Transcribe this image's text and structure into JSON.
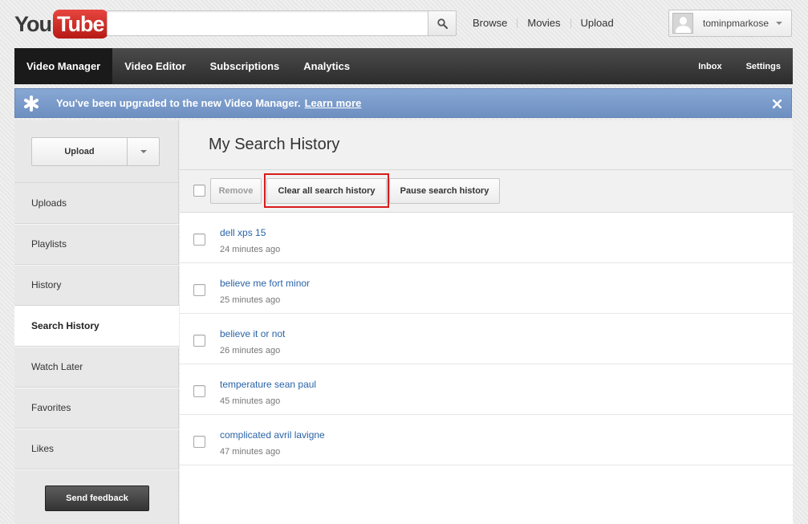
{
  "logo": {
    "you": "You",
    "tube": "Tube"
  },
  "search": {
    "value": "",
    "placeholder": ""
  },
  "top_links": [
    "Browse",
    "Movies",
    "Upload"
  ],
  "user": {
    "name": "tominpmarkose"
  },
  "nav": {
    "tabs": [
      "Video Manager",
      "Video Editor",
      "Subscriptions",
      "Analytics"
    ],
    "active": "Video Manager",
    "right": [
      "Inbox",
      "Settings"
    ]
  },
  "banner": {
    "text": "You've been upgraded to the new Video Manager.",
    "link": "Learn more"
  },
  "sidebar": {
    "upload_label": "Upload",
    "items": [
      "Uploads",
      "Playlists",
      "History",
      "Search History",
      "Watch Later",
      "Favorites",
      "Likes"
    ],
    "active": "Search History",
    "feedback_label": "Send feedback"
  },
  "main": {
    "title": "My Search History",
    "toolbar": {
      "remove": "Remove",
      "clear_all": "Clear all search history",
      "pause": "Pause search history"
    },
    "entries": [
      {
        "query": "dell xps 15",
        "time": "24 minutes ago"
      },
      {
        "query": "believe me fort minor",
        "time": "25 minutes ago"
      },
      {
        "query": "believe it or not",
        "time": "26 minutes ago"
      },
      {
        "query": "temperature sean paul",
        "time": "45 minutes ago"
      },
      {
        "query": "complicated avril lavigne",
        "time": "47 minutes ago"
      }
    ]
  },
  "colors": {
    "nav_bg": "#3a3a3a",
    "banner_bg": "#7b9bcb",
    "link": "#2a64a8",
    "highlight": "#d81b1b",
    "logo_red": "#cc181e"
  },
  "icons": [
    "search-icon",
    "avatar",
    "chevron-down-icon",
    "star-icon",
    "close-icon"
  ]
}
